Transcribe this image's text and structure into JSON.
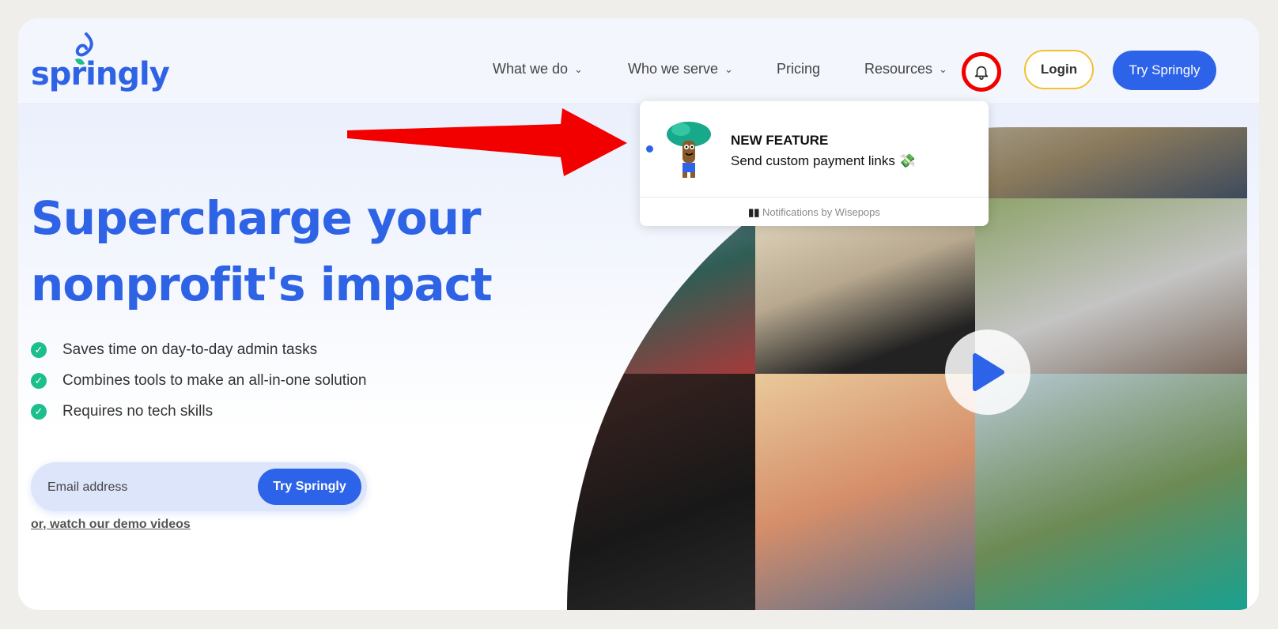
{
  "brand": {
    "name": "springly",
    "color": "#2f63e6"
  },
  "nav": {
    "items": [
      {
        "label": "What we do",
        "has_dropdown": true
      },
      {
        "label": "Who we serve",
        "has_dropdown": true
      },
      {
        "label": "Pricing",
        "has_dropdown": false
      },
      {
        "label": "Resources",
        "has_dropdown": true
      }
    ],
    "login": "Login",
    "try": "Try Springly"
  },
  "notification": {
    "title": "NEW FEATURE",
    "message": "Send custom payment links 💸",
    "footer": "Notifications by Wisepops"
  },
  "hero": {
    "line1": "Supercharge your",
    "line2": "nonprofit's impact",
    "bullets": [
      "Saves time on day-to-day admin tasks",
      "Combines tools to make an all-in-one solution",
      "Requires no tech skills"
    ],
    "email_placeholder": "Email address",
    "cta": "Try Springly",
    "demo_link": "or, watch our demo videos"
  },
  "colors": {
    "accent": "#2d63e8",
    "check": "#1cbf8c",
    "highlight": "#f20000",
    "login_border": "#f4c02c"
  }
}
